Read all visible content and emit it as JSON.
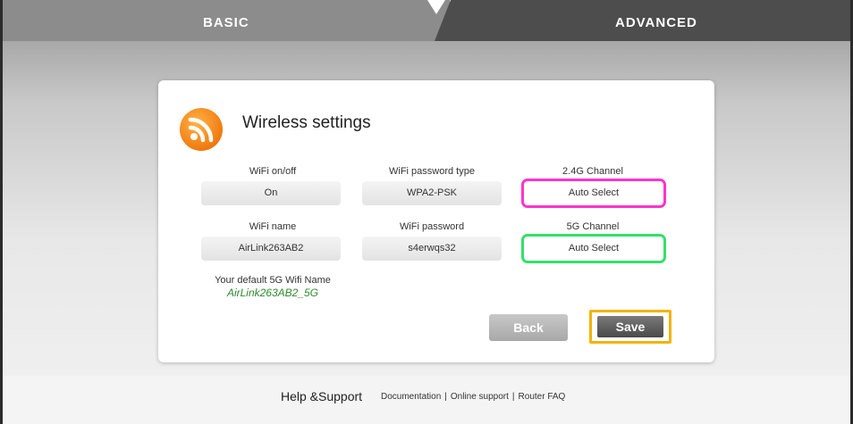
{
  "tabs": {
    "basic": "BASIC",
    "advanced": "ADVANCED"
  },
  "card": {
    "title": "Wireless settings",
    "fields": {
      "wifi_onoff": {
        "label": "WiFi on/off",
        "value": "On"
      },
      "wifi_password_type": {
        "label": "WiFi password type",
        "value": "WPA2-PSK"
      },
      "channel_24g": {
        "label": "2.4G Channel",
        "value": "Auto Select"
      },
      "wifi_name": {
        "label": "WiFi name",
        "value": "AirLink263AB2"
      },
      "wifi_password": {
        "label": "WiFi password",
        "value": "s4erwqs32"
      },
      "channel_5g": {
        "label": "5G Channel",
        "value": "Auto Select"
      }
    },
    "default_5g": {
      "label": "Your default 5G Wifi Name",
      "name": "AirLink263AB2_5G"
    },
    "buttons": {
      "back": "Back",
      "save": "Save"
    }
  },
  "footer": {
    "help": "Help &Support",
    "links": [
      "Documentation",
      "Online support",
      "Router FAQ"
    ],
    "separator": "|"
  },
  "colors": {
    "highlight_24g": "#ff33cc",
    "highlight_5g": "#33e06a",
    "highlight_save": "#f2b400",
    "default_name_text": "#2e8b2e"
  },
  "icons": {
    "wireless": "wifi-rss-icon"
  }
}
